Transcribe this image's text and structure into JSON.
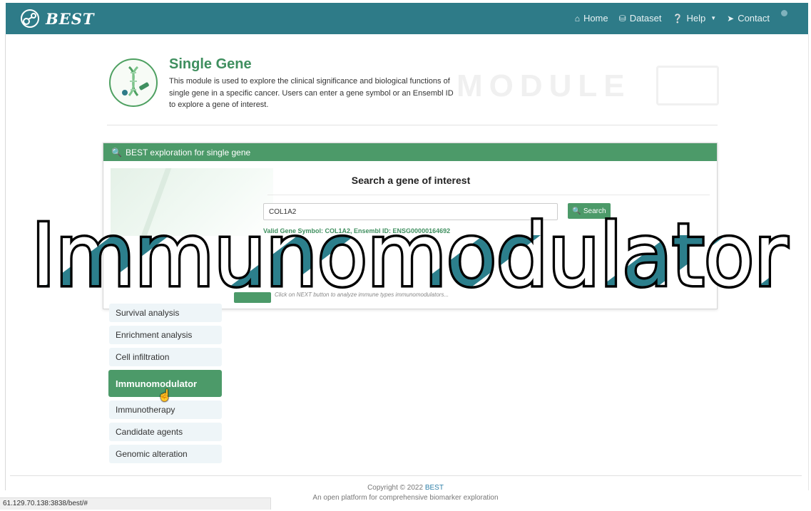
{
  "navbar": {
    "brand": "BEST",
    "links": [
      {
        "icon": "home-icon",
        "label": "Home"
      },
      {
        "icon": "database-icon",
        "label": "Dataset"
      },
      {
        "icon": "question-circle-icon",
        "label": "Help"
      },
      {
        "icon": "paper-plane-icon",
        "label": "Contact"
      }
    ]
  },
  "module": {
    "title": "Single Gene",
    "description": "This module is used to explore the clinical significance and biological functions of single gene in a specific cancer. Users can enter a gene symbol or an Ensembl ID to explore a gene of interest.",
    "background_word": "MODULE"
  },
  "panel": {
    "header": "BEST exploration for single gene",
    "heading": "Search a gene of interest",
    "input_value": "COL1A2",
    "search_label": "Search",
    "valid_text": "Valid Gene Symbol: COL1A2, Ensembl ID: ENSG00000164692",
    "hint": "Click on NEXT button to analyze immune types immunomodulators..."
  },
  "sidebar": {
    "items": [
      {
        "label": "Survival analysis",
        "active": false
      },
      {
        "label": "Enrichment analysis",
        "active": false
      },
      {
        "label": "Cell infiltration",
        "active": false
      },
      {
        "label": "Immunomodulator",
        "active": true
      },
      {
        "label": "Immunotherapy",
        "active": false
      },
      {
        "label": "Candidate agents",
        "active": false
      },
      {
        "label": "Genomic alteration",
        "active": false
      }
    ]
  },
  "footer": {
    "copyright": "Copyright © 2022 ",
    "brand": "BEST",
    "tagline": "An open platform for comprehensive biomarker exploration"
  },
  "status_bar": {
    "url": "61.129.70.138:3838/best/#"
  },
  "overlay": {
    "text": "Immunomodulator"
  },
  "colors": {
    "navbar": "#2e7b88",
    "green": "#4c9a69",
    "teal_stripe": "#2c7f8c"
  }
}
